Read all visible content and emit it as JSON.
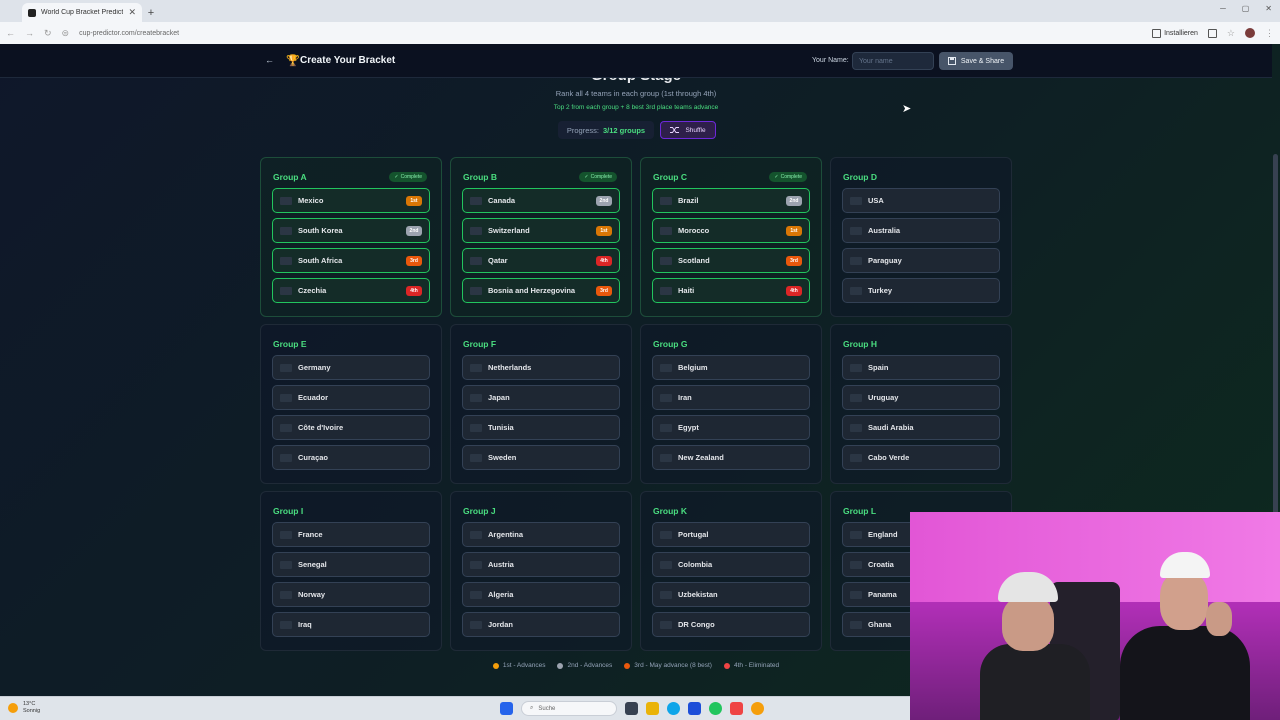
{
  "browser": {
    "tab_title": "World Cup Bracket Predictor",
    "tab_close": "✕",
    "new_tab": "+",
    "url": "cup-predictor.com/createbracket",
    "install_label": "Installieren"
  },
  "header": {
    "back": "←",
    "trophy": "🏆",
    "title": "Create Your Bracket",
    "name_label": "Your Name:",
    "name_placeholder": "Your name",
    "save_label": "Save & Share"
  },
  "stage": {
    "heading": "Group Stage",
    "subtitle": "Rank all 4 teams in each group (1st through 4th)",
    "advance_note": "Top 2 from each group + 8 best 3rd place teams advance",
    "progress_label": "Progress:",
    "progress_value": "3/12 groups",
    "shuffle_label": "Shuffle"
  },
  "groups": [
    {
      "name": "Group A",
      "status": "Complete",
      "teams": [
        {
          "name": "Mexico",
          "rank": "1st"
        },
        {
          "name": "South Korea",
          "rank": "2nd"
        },
        {
          "name": "South Africa",
          "rank": "3rd"
        },
        {
          "name": "Czechia",
          "rank": "4th"
        }
      ]
    },
    {
      "name": "Group B",
      "status": "Complete",
      "teams": [
        {
          "name": "Canada",
          "rank": "2nd"
        },
        {
          "name": "Switzerland",
          "rank": "1st"
        },
        {
          "name": "Qatar",
          "rank": "4th"
        },
        {
          "name": "Bosnia and Herzegovina",
          "rank": "3rd"
        }
      ]
    },
    {
      "name": "Group C",
      "status": "Complete",
      "teams": [
        {
          "name": "Brazil",
          "rank": "2nd"
        },
        {
          "name": "Morocco",
          "rank": "1st"
        },
        {
          "name": "Scotland",
          "rank": "3rd"
        },
        {
          "name": "Haiti",
          "rank": "4th"
        }
      ]
    },
    {
      "name": "Group D",
      "status": "",
      "teams": [
        {
          "name": "USA",
          "rank": ""
        },
        {
          "name": "Australia",
          "rank": ""
        },
        {
          "name": "Paraguay",
          "rank": ""
        },
        {
          "name": "Turkey",
          "rank": ""
        }
      ]
    },
    {
      "name": "Group E",
      "status": "",
      "teams": [
        {
          "name": "Germany",
          "rank": ""
        },
        {
          "name": "Ecuador",
          "rank": ""
        },
        {
          "name": "Côte d'Ivoire",
          "rank": ""
        },
        {
          "name": "Curaçao",
          "rank": ""
        }
      ]
    },
    {
      "name": "Group F",
      "status": "",
      "teams": [
        {
          "name": "Netherlands",
          "rank": ""
        },
        {
          "name": "Japan",
          "rank": ""
        },
        {
          "name": "Tunisia",
          "rank": ""
        },
        {
          "name": "Sweden",
          "rank": ""
        }
      ]
    },
    {
      "name": "Group G",
      "status": "",
      "teams": [
        {
          "name": "Belgium",
          "rank": ""
        },
        {
          "name": "Iran",
          "rank": ""
        },
        {
          "name": "Egypt",
          "rank": ""
        },
        {
          "name": "New Zealand",
          "rank": ""
        }
      ]
    },
    {
      "name": "Group H",
      "status": "",
      "teams": [
        {
          "name": "Spain",
          "rank": ""
        },
        {
          "name": "Uruguay",
          "rank": ""
        },
        {
          "name": "Saudi Arabia",
          "rank": ""
        },
        {
          "name": "Cabo Verde",
          "rank": ""
        }
      ]
    },
    {
      "name": "Group I",
      "status": "",
      "teams": [
        {
          "name": "France",
          "rank": ""
        },
        {
          "name": "Senegal",
          "rank": ""
        },
        {
          "name": "Norway",
          "rank": ""
        },
        {
          "name": "Iraq",
          "rank": ""
        }
      ]
    },
    {
      "name": "Group J",
      "status": "",
      "teams": [
        {
          "name": "Argentina",
          "rank": ""
        },
        {
          "name": "Austria",
          "rank": ""
        },
        {
          "name": "Algeria",
          "rank": ""
        },
        {
          "name": "Jordan",
          "rank": ""
        }
      ]
    },
    {
      "name": "Group K",
      "status": "",
      "teams": [
        {
          "name": "Portugal",
          "rank": ""
        },
        {
          "name": "Colombia",
          "rank": ""
        },
        {
          "name": "Uzbekistan",
          "rank": ""
        },
        {
          "name": "DR Congo",
          "rank": ""
        }
      ]
    },
    {
      "name": "Group L",
      "status": "",
      "teams": [
        {
          "name": "England",
          "rank": ""
        },
        {
          "name": "Croatia",
          "rank": ""
        },
        {
          "name": "Panama",
          "rank": ""
        },
        {
          "name": "Ghana",
          "rank": ""
        }
      ]
    }
  ],
  "legend": [
    {
      "label": "1st - Advances",
      "color": "#f59e0b"
    },
    {
      "label": "2nd - Advances",
      "color": "#9ca3af"
    },
    {
      "label": "3rd - May advance (8 best)",
      "color": "#ea580c"
    },
    {
      "label": "4th - Eliminated",
      "color": "#ef4444"
    }
  ],
  "taskbar": {
    "temp": "13°C",
    "weather": "Sonnig",
    "search_placeholder": "Suche"
  },
  "icons": {
    "back": "back-arrow-icon",
    "trophy": "trophy-icon",
    "save": "save-icon",
    "shuffle": "shuffle-icon",
    "complete": "check-icon"
  }
}
